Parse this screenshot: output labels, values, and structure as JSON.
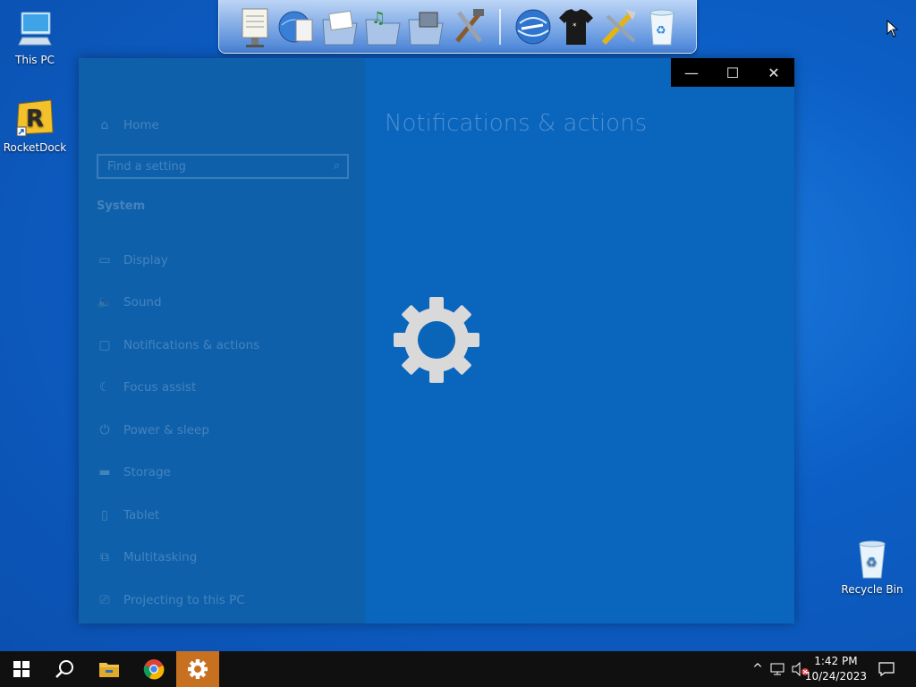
{
  "desktop": {
    "icons": [
      {
        "label": "This PC"
      },
      {
        "label": "RocketDock"
      },
      {
        "label": "Recycle Bin"
      }
    ]
  },
  "dock": {
    "items": [
      "notepad-icon",
      "globe-document-icon",
      "documents-folder-icon",
      "music-folder-icon",
      "pictures-folder-icon",
      "tools-icon",
      "internet-globe-icon",
      "tshirt-icon",
      "settings-tools-icon",
      "recycle-bin-icon"
    ]
  },
  "window": {
    "controls": {
      "minimize": "—",
      "maximize": "☐",
      "close": "✕"
    },
    "sidebar": {
      "home": "Home",
      "search_placeholder": "Find a setting",
      "section": "System",
      "items": [
        {
          "label": "Display",
          "icon": "monitor-icon"
        },
        {
          "label": "Sound",
          "icon": "speaker-icon"
        },
        {
          "label": "Notifications & actions",
          "icon": "notification-icon"
        },
        {
          "label": "Focus assist",
          "icon": "moon-icon"
        },
        {
          "label": "Power & sleep",
          "icon": "power-icon"
        },
        {
          "label": "Storage",
          "icon": "storage-icon"
        },
        {
          "label": "Tablet",
          "icon": "tablet-icon"
        },
        {
          "label": "Multitasking",
          "icon": "multitasking-icon"
        },
        {
          "label": "Projecting to this PC",
          "icon": "projecting-icon"
        }
      ]
    },
    "content": {
      "title": "Notifications & actions"
    }
  },
  "taskbar": {
    "apps": [
      "start-icon",
      "search-icon",
      "file-explorer-icon",
      "chrome-icon",
      "settings-icon"
    ],
    "clock": {
      "time": "1:42 PM",
      "date": "10/24/2023"
    }
  },
  "colors": {
    "desktop": "#0c5fc6",
    "window": "#0a63b6",
    "taskbar": "#101010",
    "active_app": "#c7701f"
  }
}
